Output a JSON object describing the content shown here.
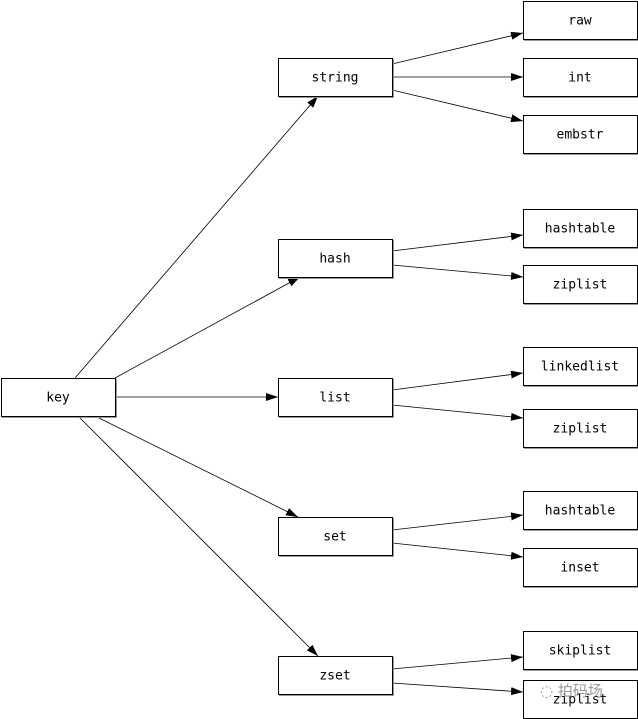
{
  "nodes": {
    "key": "key",
    "string": "string",
    "hash": "hash",
    "list": "list",
    "set": "set",
    "zset": "zset",
    "raw": "raw",
    "int": "int",
    "embstr": "embstr",
    "hash_hashtable": "hashtable",
    "hash_ziplist": "ziplist",
    "list_linkedlist": "linkedlist",
    "list_ziplist": "ziplist",
    "set_hashtable": "hashtable",
    "set_inset": "inset",
    "zset_skiplist": "skiplist",
    "zset_ziplist": "ziplist"
  },
  "edges": [
    [
      "key",
      "string"
    ],
    [
      "key",
      "hash"
    ],
    [
      "key",
      "list"
    ],
    [
      "key",
      "set"
    ],
    [
      "key",
      "zset"
    ],
    [
      "string",
      "raw"
    ],
    [
      "string",
      "int"
    ],
    [
      "string",
      "embstr"
    ],
    [
      "hash",
      "hash_hashtable"
    ],
    [
      "hash",
      "hash_ziplist"
    ],
    [
      "list",
      "list_linkedlist"
    ],
    [
      "list",
      "list_ziplist"
    ],
    [
      "set",
      "set_hashtable"
    ],
    [
      "set",
      "set_inset"
    ],
    [
      "zset",
      "zset_skiplist"
    ],
    [
      "zset",
      "zset_ziplist"
    ]
  ],
  "watermark": "拍码场"
}
